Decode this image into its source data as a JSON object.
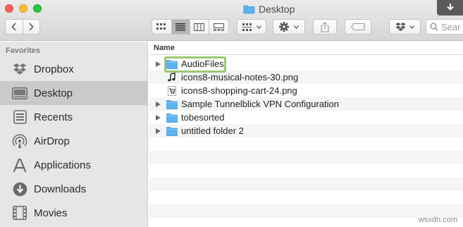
{
  "window": {
    "title": "Desktop"
  },
  "toolbar": {
    "back_icon": "chevron-left-icon",
    "forward_icon": "chevron-right-icon",
    "view_modes": [
      "icon-view-icon",
      "list-view-icon",
      "column-view-icon",
      "gallery-view-icon"
    ],
    "active_view": "list",
    "group_by_icon": "group-by-icon",
    "action_icon": "gear-icon",
    "share_icon": "share-icon",
    "tags_icon": "tag-icon",
    "dropbox_icon": "dropbox-icon",
    "search_placeholder": "Sear"
  },
  "sidebar": {
    "header": "Favorites",
    "items": [
      {
        "label": "Dropbox",
        "icon": "dropbox-icon",
        "selected": false
      },
      {
        "label": "Desktop",
        "icon": "desktop-icon",
        "selected": true
      },
      {
        "label": "Recents",
        "icon": "recents-icon",
        "selected": false
      },
      {
        "label": "AirDrop",
        "icon": "airdrop-icon",
        "selected": false
      },
      {
        "label": "Applications",
        "icon": "applications-icon",
        "selected": false
      },
      {
        "label": "Downloads",
        "icon": "downloads-icon",
        "selected": false
      },
      {
        "label": "Movies",
        "icon": "movies-icon",
        "selected": false
      }
    ]
  },
  "file_list": {
    "column_header": "Name",
    "rows": [
      {
        "name": "AudioFiles",
        "type": "folder",
        "expandable": true,
        "focused": true
      },
      {
        "name": "icons8-musical-notes-30.png",
        "type": "png-music",
        "expandable": false
      },
      {
        "name": "icons8-shopping-cart-24.png",
        "type": "png-cart",
        "expandable": false
      },
      {
        "name": "Sample Tunnelblick VPN Configuration",
        "type": "folder",
        "expandable": true
      },
      {
        "name": "tobesorted",
        "type": "folder",
        "expandable": true
      },
      {
        "name": "untitled folder 2",
        "type": "folder",
        "expandable": true
      }
    ]
  },
  "watermark": "wsxdn.com",
  "colors": {
    "folder_blue": "#5bb3f0",
    "focus_ring": "#9bc86f",
    "selected_sidebar": "#cacaca"
  }
}
